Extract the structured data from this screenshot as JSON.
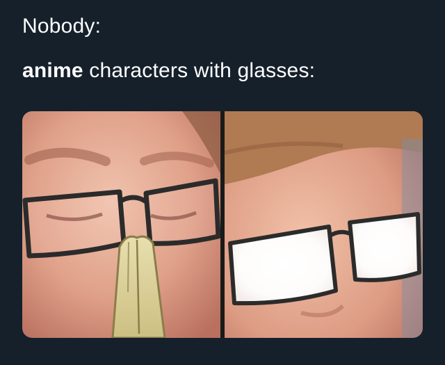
{
  "post": {
    "line1": "Nobody:",
    "line2_bold": "anime",
    "line2_rest": " characters with glasses:"
  },
  "colors": {
    "background": "#15202b",
    "text": "#ffffff",
    "skin": "#e2a58d",
    "hair": "#b07a52",
    "glasses_frame": "#2b2b2b",
    "anime_hand": "#d9cf9a",
    "lens_glare": "#ffffff"
  },
  "media": {
    "panel_left": {
      "description_icon": "man-adjusting-glasses-anime-hand",
      "state": "eyes-visible"
    },
    "panel_right": {
      "description_icon": "man-with-glowing-glasses",
      "state": "lenses-glowing"
    }
  }
}
